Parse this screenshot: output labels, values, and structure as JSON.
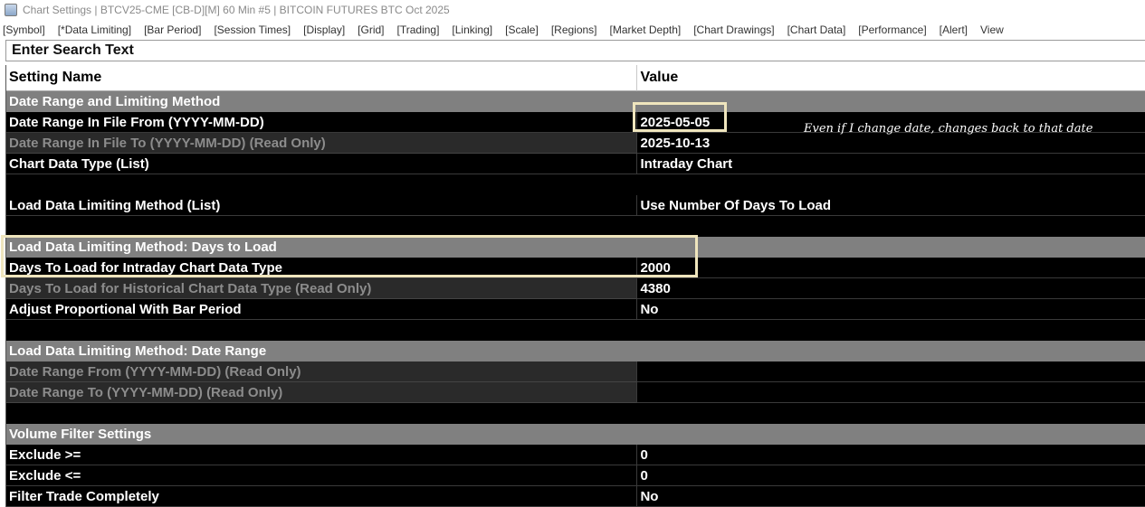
{
  "window": {
    "title": "Chart Settings | BTCV25-CME [CB-D][M]  60 Min  #5 | BITCOIN FUTURES BTC Oct 2025"
  },
  "tabs": [
    "[Symbol]",
    "[*Data Limiting]",
    "[Bar Period]",
    "[Session Times]",
    "[Display]",
    "[Grid]",
    "[Trading]",
    "[Linking]",
    "[Scale]",
    "[Regions]",
    "[Market Depth]",
    "[Chart Drawings]",
    "[Chart Data]",
    "[Performance]",
    "[Alert]",
    "View"
  ],
  "search": {
    "placeholder": "Enter Search Text"
  },
  "columns": {
    "name": "Setting Name",
    "value": "Value"
  },
  "rows": [
    {
      "type": "section",
      "name": "Date Range and Limiting Method",
      "value": ""
    },
    {
      "type": "normal",
      "name": "Date Range In File From (YYYY-MM-DD)",
      "value": "2025-05-05"
    },
    {
      "type": "readonly",
      "name": "Date Range In File To (YYYY-MM-DD) (Read Only)",
      "value": "2025-10-13"
    },
    {
      "type": "normal",
      "name": "Chart Data Type (List)",
      "value": "Intraday Chart"
    },
    {
      "type": "spacer",
      "name": "",
      "value": ""
    },
    {
      "type": "normal",
      "name": "Load Data Limiting Method (List)",
      "value": "Use Number Of Days To Load"
    },
    {
      "type": "spacer",
      "name": "",
      "value": ""
    },
    {
      "type": "section",
      "name": "Load Data Limiting Method: Days to Load",
      "value": ""
    },
    {
      "type": "normal",
      "name": "Days To Load for Intraday Chart Data Type",
      "value": "2000"
    },
    {
      "type": "readonly",
      "name": "Days To Load for Historical Chart Data Type (Read Only)",
      "value": "4380"
    },
    {
      "type": "normal",
      "name": "Adjust Proportional With Bar Period",
      "value": "No"
    },
    {
      "type": "spacer",
      "name": "",
      "value": ""
    },
    {
      "type": "section",
      "name": "Load Data Limiting Method: Date Range",
      "value": ""
    },
    {
      "type": "readonly-empty",
      "name": "Date Range From (YYYY-MM-DD) (Read Only)",
      "value": ""
    },
    {
      "type": "readonly-empty",
      "name": "Date Range To (YYYY-MM-DD) (Read Only)",
      "value": ""
    },
    {
      "type": "spacer",
      "name": "",
      "value": ""
    },
    {
      "type": "section",
      "name": "Volume Filter Settings",
      "value": ""
    },
    {
      "type": "normal",
      "name": "Exclude >=",
      "value": "0"
    },
    {
      "type": "normal",
      "name": "Exclude <=",
      "value": "0"
    },
    {
      "type": "normal",
      "name": "Filter Trade Completely",
      "value": "No"
    }
  ],
  "annotation": {
    "note": "Even if I change date, changes back to that date"
  },
  "colors": {
    "section_bg": "#808080",
    "row_bg": "#000000",
    "readonly_text": "#8c8c8c",
    "highlight_box": "#efe5bd"
  }
}
